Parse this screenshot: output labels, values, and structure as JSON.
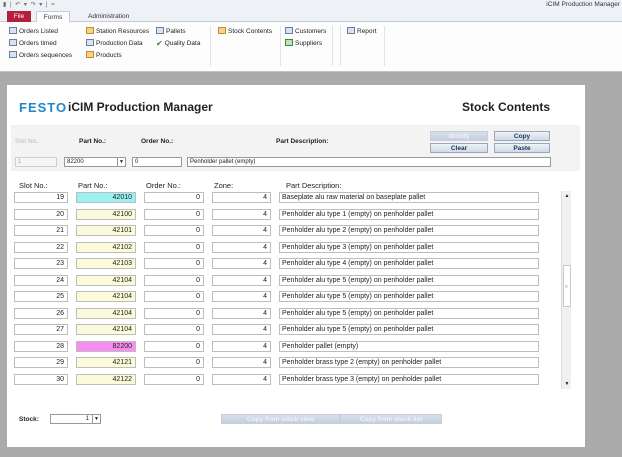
{
  "window": {
    "title": "iCIM Production Manager",
    "quick_access": "▮ | ↶ ▾ ↷ ▾ | ="
  },
  "tabs": [
    {
      "label": "File"
    },
    {
      "label": "Forms"
    },
    {
      "label": "Administration"
    }
  ],
  "ribbon": {
    "orders_listed": "Orders Listed",
    "orders_timed": "Orders timed",
    "orders_sequences": "Orders sequences",
    "station_resources": "Station Resources",
    "production_data": "Production Data",
    "products": "Products",
    "pallets": "Pallets",
    "quality_data": "Quality Data",
    "stock_contents": "Stock Contents",
    "customers": "Customers",
    "suppliers": "Suppliers",
    "report": "Report"
  },
  "header": {
    "brand": "FESTO",
    "app_name": "iCIM Production Manager",
    "page_title": "Stock Contents"
  },
  "filter": {
    "slot_label": "Slot No.:",
    "part_label": "Part No.:",
    "order_label": "Order No.:",
    "desc_label": "Part Description:",
    "modify_label": "Modify",
    "copy_label": "Copy",
    "clear_label": "Clear",
    "paste_label": "Paste",
    "slot_value": "1",
    "part_value": "82200",
    "order_value": "0",
    "desc_value": "Penholder pallet (empty)"
  },
  "columns": {
    "slot": "Slot No.:",
    "part": "Part No.:",
    "order": "Order No.:",
    "zone": "Zone:",
    "desc": "Part Description:"
  },
  "colors": {
    "part_cell_default": "#fbfbd9",
    "part_cell_cyan": "#9df0f0",
    "part_cell_pink": "#f58ef0",
    "brand": "#2287c8",
    "file_tab": "#b4203b"
  },
  "rows": [
    {
      "slot": "19",
      "part": "42010",
      "order": "0",
      "zone": "4",
      "desc": "Baseplate alu raw material on baseplate pallet",
      "part_color": "#9df0f0"
    },
    {
      "slot": "20",
      "part": "42100",
      "order": "0",
      "zone": "4",
      "desc": "Penholder alu type 1 (empty) on penholder pallet",
      "part_color": "#fbfbd9"
    },
    {
      "slot": "21",
      "part": "42101",
      "order": "0",
      "zone": "4",
      "desc": "Penholder alu type 2 (empty) on penholder pallet",
      "part_color": "#fbfbd9"
    },
    {
      "slot": "22",
      "part": "42102",
      "order": "0",
      "zone": "4",
      "desc": "Penholder alu type 3 (empty) on penholder pallet",
      "part_color": "#fbfbd9"
    },
    {
      "slot": "23",
      "part": "42103",
      "order": "0",
      "zone": "4",
      "desc": "Penholder alu type 4 (empty) on penholder pallet",
      "part_color": "#fbfbd9"
    },
    {
      "slot": "24",
      "part": "42104",
      "order": "0",
      "zone": "4",
      "desc": "Penholder alu type 5 (empty) on penholder pallet",
      "part_color": "#fbfbd9"
    },
    {
      "slot": "25",
      "part": "42104",
      "order": "0",
      "zone": "4",
      "desc": "Penholder alu type 5 (empty) on penholder pallet",
      "part_color": "#fbfbd9"
    },
    {
      "slot": "26",
      "part": "42104",
      "order": "0",
      "zone": "4",
      "desc": "Penholder alu type 5 (empty) on penholder pallet",
      "part_color": "#fbfbd9"
    },
    {
      "slot": "27",
      "part": "42104",
      "order": "0",
      "zone": "4",
      "desc": "Penholder alu type 5 (empty) on penholder pallet",
      "part_color": "#fbfbd9"
    },
    {
      "slot": "28",
      "part": "82200",
      "order": "0",
      "zone": "4",
      "desc": "Penholder pallet (empty)",
      "part_color": "#f58ef0"
    },
    {
      "slot": "29",
      "part": "42121",
      "order": "0",
      "zone": "4",
      "desc": "Penholder brass type 2 (empty) on penholder pallet",
      "part_color": "#fbfbd9"
    },
    {
      "slot": "30",
      "part": "42122",
      "order": "0",
      "zone": "4",
      "desc": "Penholder brass type 3 (empty) on penholder pallet",
      "part_color": "#fbfbd9"
    }
  ],
  "footer": {
    "stock_label": "Stock:",
    "stock_value": "1",
    "copy_from_stock_view": "Copy from stock view",
    "copy_from_stock_list": "Copy from stock list"
  },
  "icons": {
    "orders": "form-icon",
    "station": "station-icon",
    "pallets": "grid-icon",
    "quality": "check-icon",
    "stock": "folder-icon",
    "customers": "people-icon",
    "suppliers": "truck-icon",
    "report": "report-icon"
  }
}
